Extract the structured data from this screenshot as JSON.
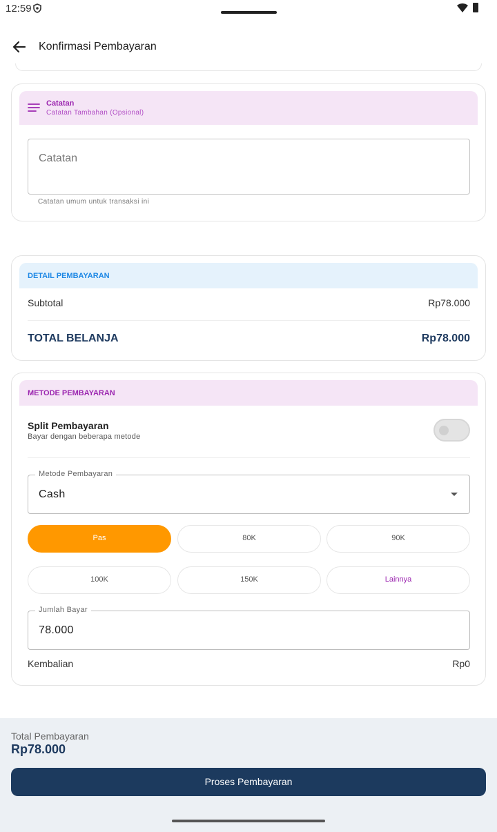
{
  "status": {
    "time": "12:59"
  },
  "appbar": {
    "title": "Konfirmasi Pembayaran"
  },
  "catatan": {
    "title": "Catatan",
    "subtitle": "Catatan Tambahan (Opsional)",
    "placeholder": "Catatan",
    "helper": "Catatan umum untuk transaksi ini"
  },
  "detail": {
    "title": "DETAIL PEMBAYARAN",
    "subtotal_label": "Subtotal",
    "subtotal_value": "Rp78.000",
    "total_label": "TOTAL BELANJA",
    "total_value": "Rp78.000"
  },
  "metode": {
    "title": "METODE PEMBAYARAN",
    "split_title": "Split Pembayaran",
    "split_sub": "Bayar dengan beberapa metode",
    "split_enabled": false,
    "method_label": "Metode Pembayaran",
    "method_value": "Cash",
    "chips": [
      "Pas",
      "80K",
      "90K",
      "100K",
      "150K",
      "Lainnya"
    ],
    "amount_label": "Jumlah Bayar",
    "amount_value": "78.000",
    "change_label": "Kembalian",
    "change_value": "Rp0"
  },
  "footer": {
    "total_label": "Total Pembayaran",
    "total_value": "Rp78.000",
    "button_label": "Proses Pembayaran"
  },
  "colors": {
    "primary": "#1c3a5e",
    "accent_orange": "#ff9800",
    "purple": "#9c27b0",
    "blue": "#1e88e5"
  }
}
